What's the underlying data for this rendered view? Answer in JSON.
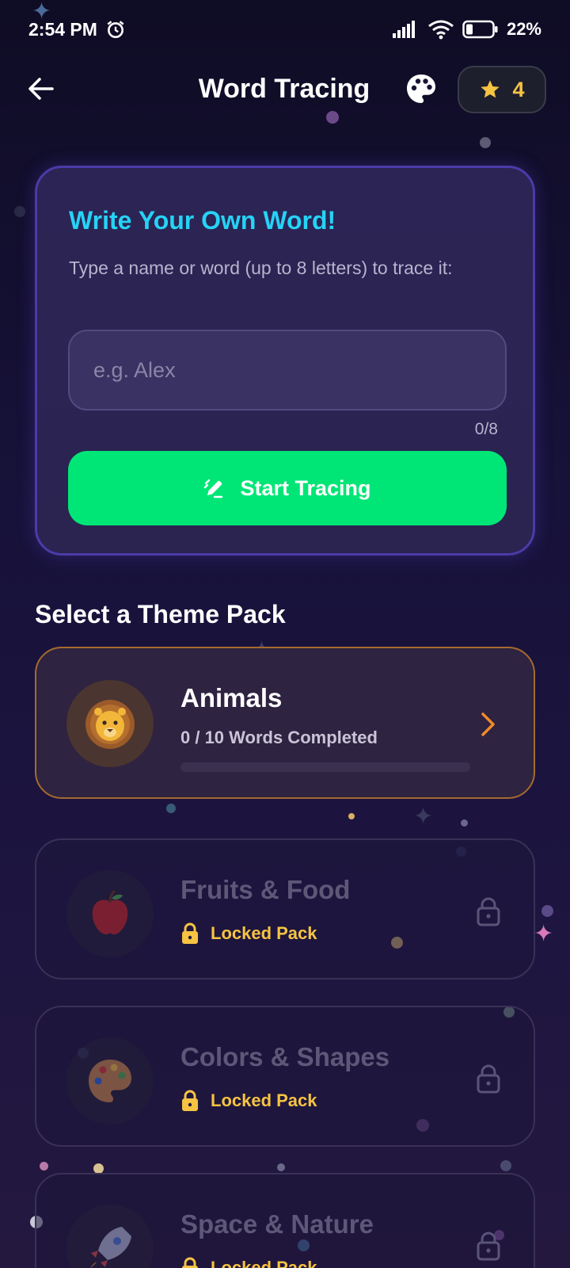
{
  "status_bar": {
    "time": "2:54 PM",
    "battery": "22%",
    "icons": [
      "alarm-icon",
      "signal-icon",
      "wifi-icon",
      "battery-icon"
    ]
  },
  "header": {
    "title": "Word Tracing",
    "back_icon": "arrow-left-icon",
    "palette_icon": "palette-icon",
    "stars": "4"
  },
  "custom_word": {
    "title": "Write Your Own Word!",
    "description": "Type a name or word (up to 8 letters) to trace it:",
    "input_placeholder": "e.g. Alex",
    "input_value": "",
    "char_count": "0/8",
    "start_button": "Start Tracing"
  },
  "theme_section": {
    "title": "Select a Theme Pack",
    "packs": [
      {
        "name": "Animals",
        "status": "0 / 10 Words Completed",
        "progress": 0,
        "locked": false,
        "icon": "lion-icon"
      },
      {
        "name": "Fruits & Food",
        "status": "Locked Pack",
        "locked": true,
        "icon": "apple-icon"
      },
      {
        "name": "Colors & Shapes",
        "status": "Locked Pack",
        "locked": true,
        "icon": "palette-icon"
      },
      {
        "name": "Space & Nature",
        "status": "Locked Pack",
        "locked": true,
        "icon": "rocket-icon"
      }
    ]
  },
  "colors": {
    "accent_green": "#00e676",
    "title_cyan": "#25d3f5",
    "star_gold": "#f6c343",
    "active_border": "#a56a2e",
    "card_border": "#4b3ba8"
  }
}
